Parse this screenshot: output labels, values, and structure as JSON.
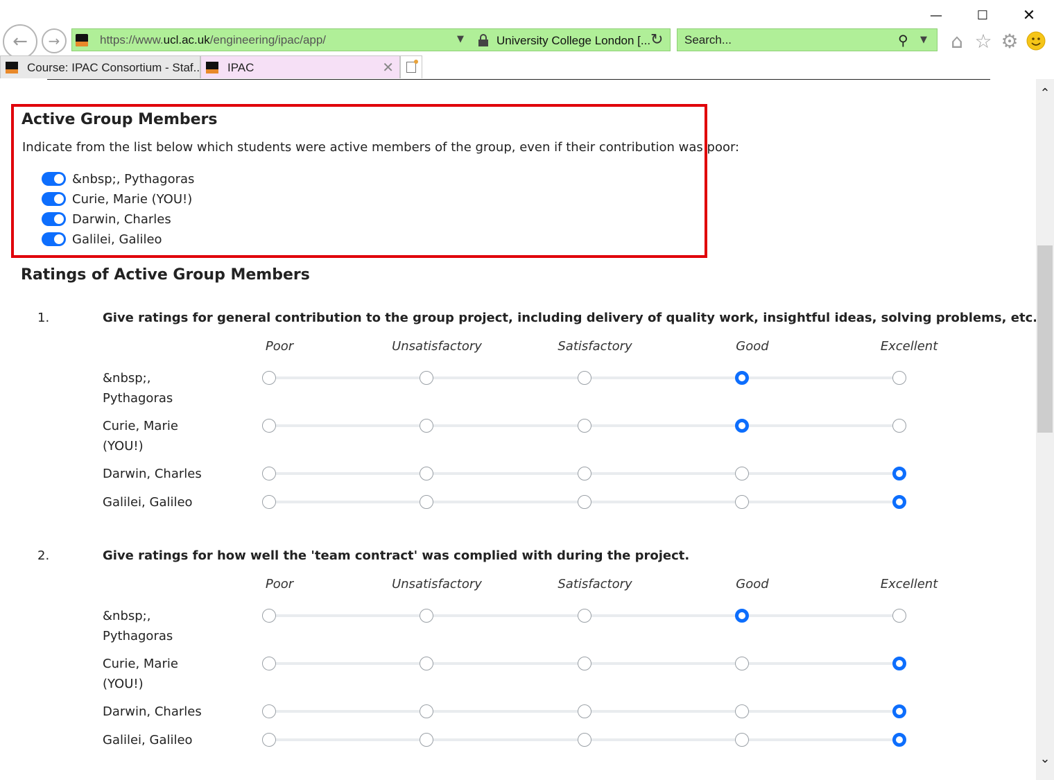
{
  "browser": {
    "url_prefix": "https://www.",
    "url_domain": "ucl.ac.uk",
    "url_path": "/engineering/ipac/app/",
    "site_identity": "University College London [...",
    "search_placeholder": "Search...",
    "tabs": [
      {
        "label": "Course: IPAC Consortium - Staf..."
      },
      {
        "label": "IPAC"
      }
    ]
  },
  "active_members": {
    "title": "Active Group Members",
    "description": "Indicate from the list below which students were active members of the group, even if their contribution was poor:",
    "members": [
      {
        "name": "&nbsp;, Pythagoras",
        "active": true
      },
      {
        "name": "Curie, Marie (YOU!)",
        "active": true
      },
      {
        "name": "Darwin, Charles",
        "active": true
      },
      {
        "name": "Galilei, Galileo",
        "active": true
      }
    ]
  },
  "ratings": {
    "title": "Ratings of Active Group Members",
    "scale": [
      "Poor",
      "Unsatisfactory",
      "Satisfactory",
      "Good",
      "Excellent"
    ],
    "questions": [
      {
        "number": "1.",
        "text": "Give ratings for general contribution to the group project, including delivery of quality work, insightful ideas, solving problems, etc.",
        "rows": [
          {
            "name": "&nbsp;, Pythagoras",
            "rating": "Good"
          },
          {
            "name": "Curie, Marie (YOU!)",
            "rating": "Good"
          },
          {
            "name": "Darwin, Charles",
            "rating": "Excellent"
          },
          {
            "name": "Galilei, Galileo",
            "rating": "Excellent"
          }
        ]
      },
      {
        "number": "2.",
        "text": "Give ratings for how well the 'team contract' was complied with during the project.",
        "rows": [
          {
            "name": "&nbsp;, Pythagoras",
            "rating": "Good"
          },
          {
            "name": "Curie, Marie (YOU!)",
            "rating": "Excellent"
          },
          {
            "name": "Darwin, Charles",
            "rating": "Excellent"
          },
          {
            "name": "Galilei, Galileo",
            "rating": "Excellent"
          }
        ]
      }
    ]
  },
  "colors": {
    "accent": "#0d6efd",
    "highlight_border": "#e0000a",
    "address_bar": "#b0ef98",
    "active_tab": "#f6e0f6"
  }
}
